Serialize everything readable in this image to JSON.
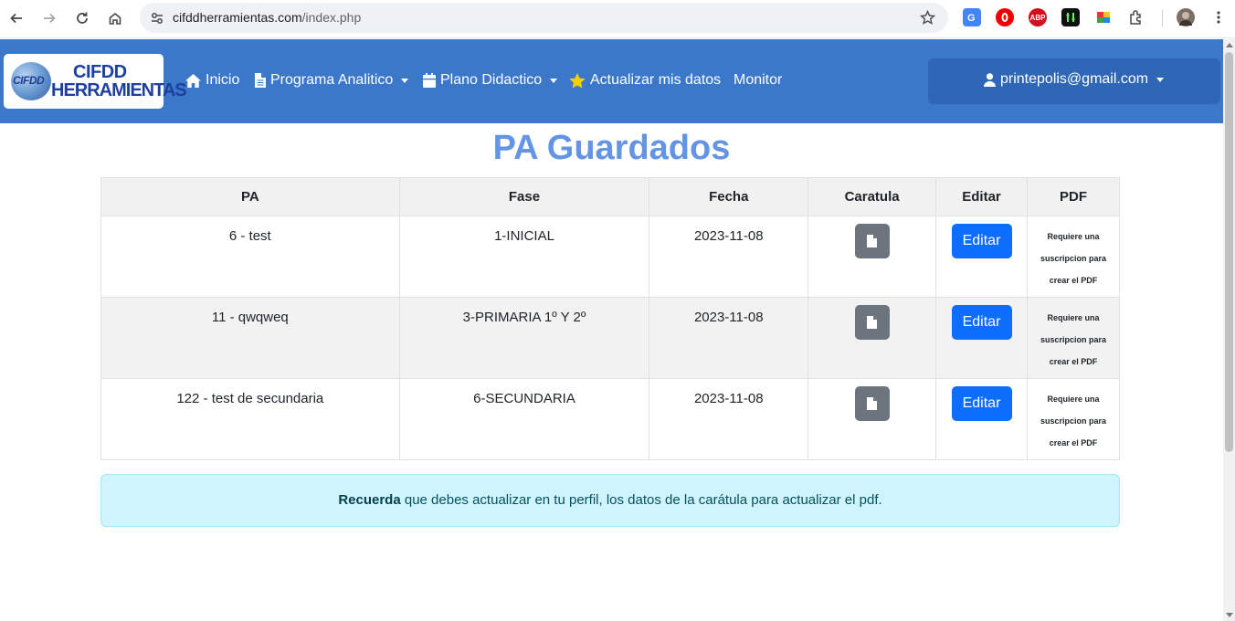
{
  "browser": {
    "url_host": "cifddherramientas.com",
    "url_path": "/index.php"
  },
  "brand": {
    "globe_text": "CIFDD",
    "line1": "CIFDD",
    "line2": "HERRAMIENTAS"
  },
  "nav": {
    "inicio": "Inicio",
    "programa": "Programa Analitico",
    "plano": "Plano Didactico",
    "actualizar": "Actualizar mis datos",
    "monitor": "Monitor",
    "user": "printepolis@gmail.com"
  },
  "page": {
    "title": "PA Guardados"
  },
  "table": {
    "headers": [
      "PA",
      "Fase",
      "Fecha",
      "Caratula",
      "Editar",
      "PDF"
    ],
    "rows": [
      {
        "pa": "6 - test",
        "fase": "1-INICIAL",
        "fecha": "2023-11-08",
        "editar": "Editar",
        "pdf": "Requiere una suscripcion para crear el PDF"
      },
      {
        "pa": "11 - qwqweq",
        "fase": "3-PRIMARIA 1º Y 2º",
        "fecha": "2023-11-08",
        "editar": "Editar",
        "pdf": "Requiere una suscripcion para crear el PDF"
      },
      {
        "pa": "122 - test de secundaria",
        "fase": "6-SECUNDARIA",
        "fecha": "2023-11-08",
        "editar": "Editar",
        "pdf": "Requiere una suscripcion para crear el PDF"
      }
    ]
  },
  "alert": {
    "strong": "Recuerda",
    "text": " que debes actualizar en tu perfil, los datos de la carátula para actualizar el pdf."
  },
  "extensions": {
    "abp": "ABP"
  },
  "colors": {
    "navbar": "#3b78c9",
    "title": "#6495e4",
    "primary_button": "#0d6efd",
    "secondary_button": "#6c757d",
    "alert_bg": "#cff4fc"
  }
}
